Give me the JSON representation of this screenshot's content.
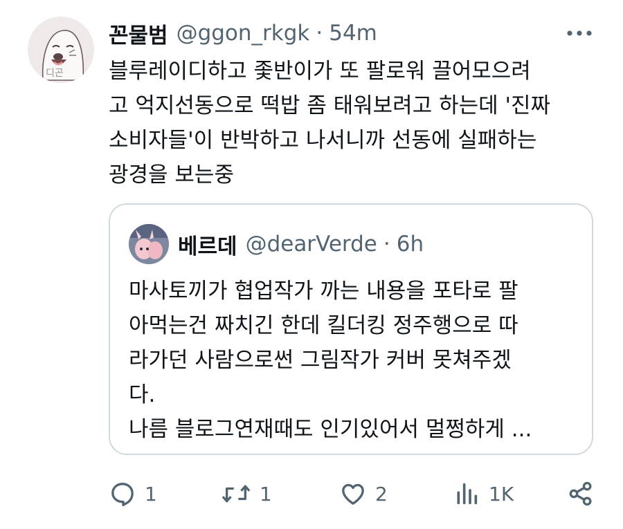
{
  "tweet": {
    "author_name": "꼰물범",
    "author_handle": "@ggon_rkgk",
    "separator": "·",
    "time": "54m",
    "avatar_text": "디곤",
    "text": "블루레이디하고 좇반이가 또 팔로워 끌어모으려\n고 억지선동으로 떡밥 좀 태워보려고 하는데 '진짜\n소비자들'이 반박하고 나서니까 선동에 실패하는\n광경을 보는중"
  },
  "quote": {
    "author_name": "베르데",
    "author_handle": "@dearVerde",
    "separator": "·",
    "time": "6h",
    "text": "마사토끼가 협업작가 까는 내용을 포타로 팔\n아먹는건 짜치긴 한데 킬더킹 정주행으로 따\n라가던 사람으로썬 그림작가 커버 못쳐주겠\n다.\n나름 블로그연재때도 인기있어서 멀쩡하게 ..."
  },
  "actions": {
    "replies": "1",
    "retweets": "1",
    "likes": "2",
    "views": "1K"
  },
  "icons": {
    "more": "more-horizontal-icon",
    "reply": "reply-icon",
    "retweet": "retweet-icon",
    "like": "heart-icon",
    "views": "views-chart-icon",
    "share": "share-icon"
  },
  "colors": {
    "text": "#0f1419",
    "secondary": "#536471",
    "border": "#cfd9de"
  }
}
